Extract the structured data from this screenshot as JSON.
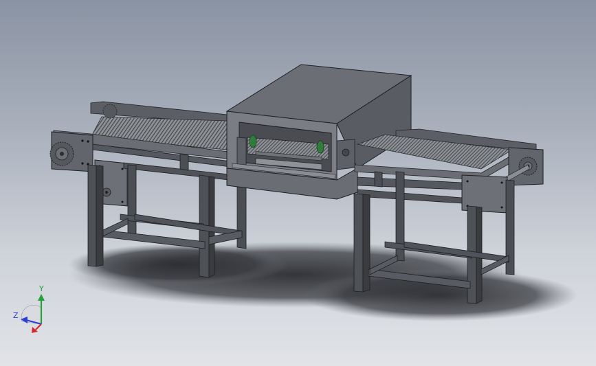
{
  "viewport": {
    "background_top": "#8a93a3",
    "background_bottom": "#e1e3e7"
  },
  "triad": {
    "y_label": "Y",
    "z_label": "Z",
    "x_color": "#d42a2a",
    "y_color": "#27a13a",
    "z_color": "#2a3fd4"
  }
}
